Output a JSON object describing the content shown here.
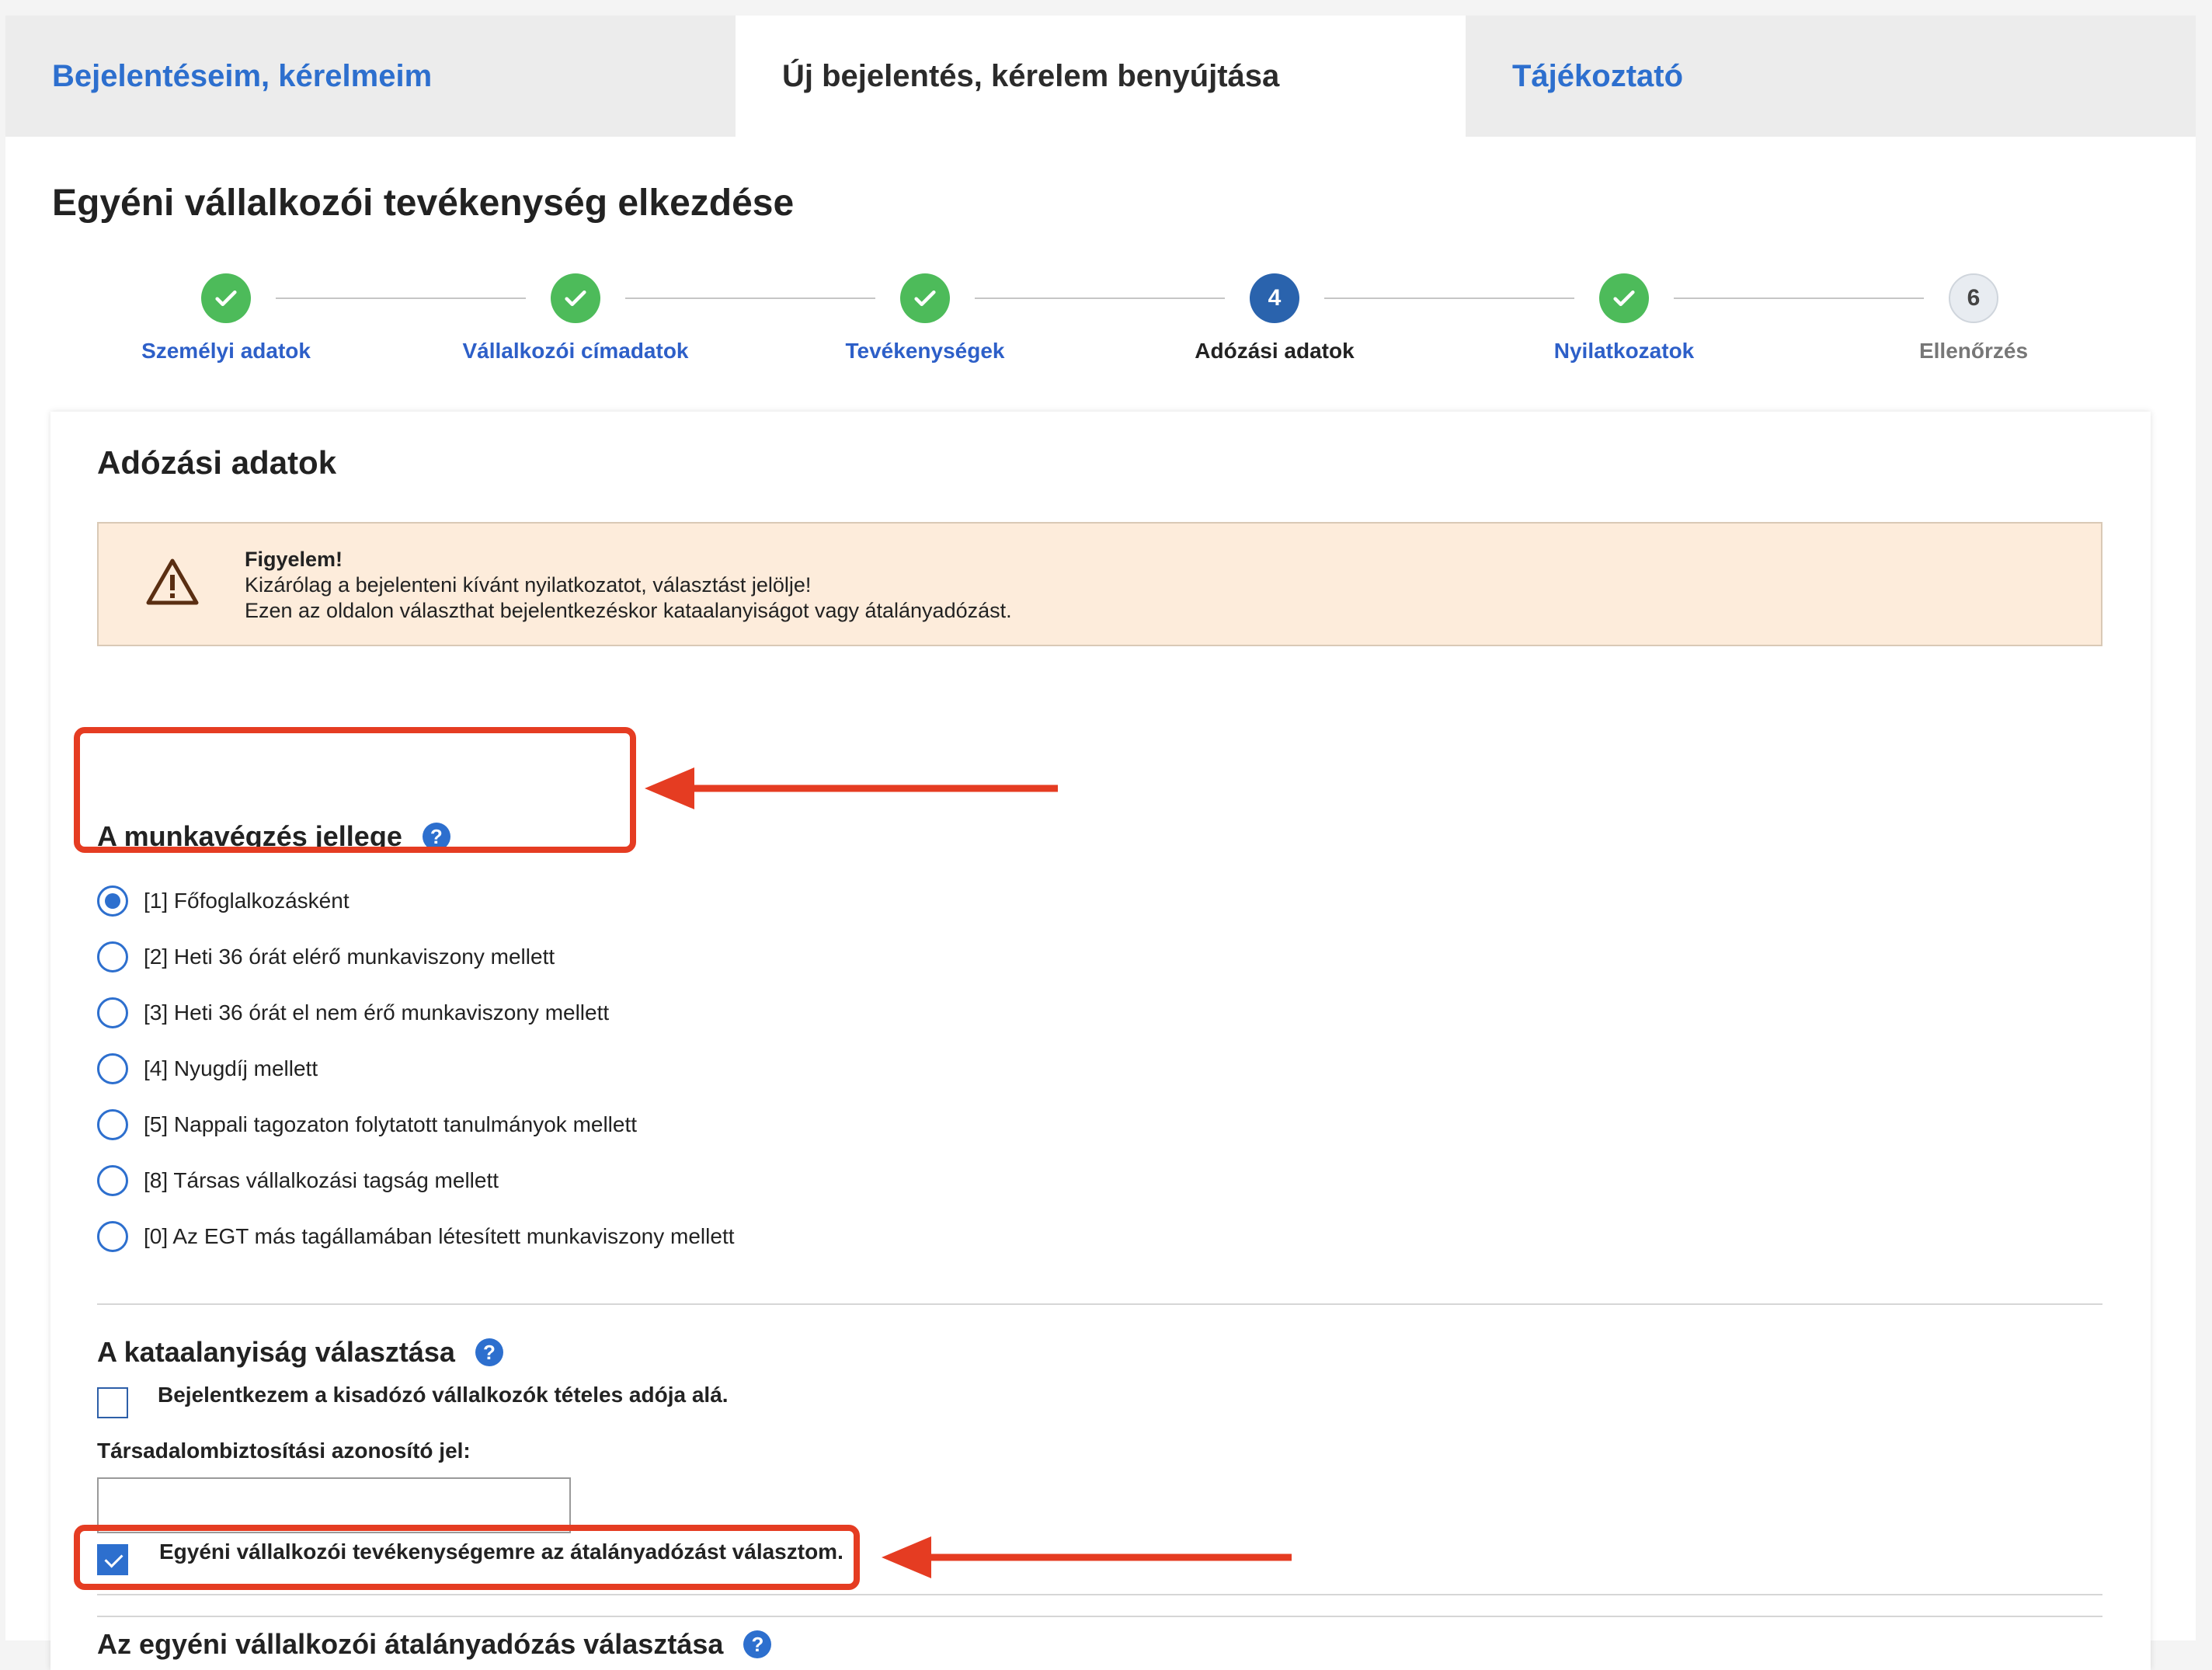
{
  "tabs": [
    {
      "label": "Bejelentéseim, kérelmeim",
      "active": false
    },
    {
      "label": "Új bejelentés, kérelem benyújtása",
      "active": true
    },
    {
      "label": "Tájékoztató",
      "active": false
    }
  ],
  "page_title": "Egyéni vállalkozói tevékenység elkezdése",
  "stepper": {
    "steps": [
      {
        "label": "Személyi adatok",
        "state": "done"
      },
      {
        "label": "Vállalkozói címadatok",
        "state": "done"
      },
      {
        "label": "Tevékenységek",
        "state": "done"
      },
      {
        "label": "Adózási adatok",
        "state": "current",
        "number": "4"
      },
      {
        "label": "Nyilatkozatok",
        "state": "done"
      },
      {
        "label": "Ellenőrzés",
        "state": "todo",
        "number": "6"
      }
    ]
  },
  "section": {
    "title": "Adózási adatok",
    "warning": {
      "title": "Figyelem!",
      "line1": "Kizárólag a bejelenteni kívánt nyilatkozatot, választást jelölje!",
      "line2": "Ezen az oldalon választhat bejelentkezéskor kataalanyiságot vagy átalányadózást."
    },
    "work_type": {
      "title": "A munkavégzés jellege",
      "help": "?",
      "options": [
        {
          "label": "[1] Főfoglalkozásként",
          "checked": true
        },
        {
          "label": "[2] Heti 36 órát elérő munkaviszony mellett",
          "checked": false
        },
        {
          "label": "[3] Heti 36 órát el nem érő munkaviszony mellett",
          "checked": false
        },
        {
          "label": "[4] Nyugdíj mellett",
          "checked": false
        },
        {
          "label": "[5] Nappali tagozaton folytatott tanulmányok mellett",
          "checked": false
        },
        {
          "label": "[8] Társas vállalkozási tagság mellett",
          "checked": false
        },
        {
          "label": "[0] Az EGT más tagállamában létesített munkaviszony mellett",
          "checked": false
        }
      ]
    },
    "kata": {
      "title": "A kataalanyiság választása",
      "help": "?",
      "checkbox_label": "Bejelentkezem a kisadózó vállalkozók tételes adója alá.",
      "checked": false,
      "field_label": "Társadalombiztosítási azonosító jel:",
      "field_value": ""
    },
    "flat_rate": {
      "title": "Az egyéni vállalkozói átalányadózás választása",
      "help": "?",
      "checkbox_label": "Egyéni vállalkozói tevékenységemre az átalányadózást választom.",
      "checked": true
    }
  },
  "colors": {
    "accent": "#2d6fce",
    "done": "#4dbb5a",
    "current_step": "#2a63ad",
    "annotation": "#e53c22",
    "warning_bg": "#fdecdb"
  }
}
